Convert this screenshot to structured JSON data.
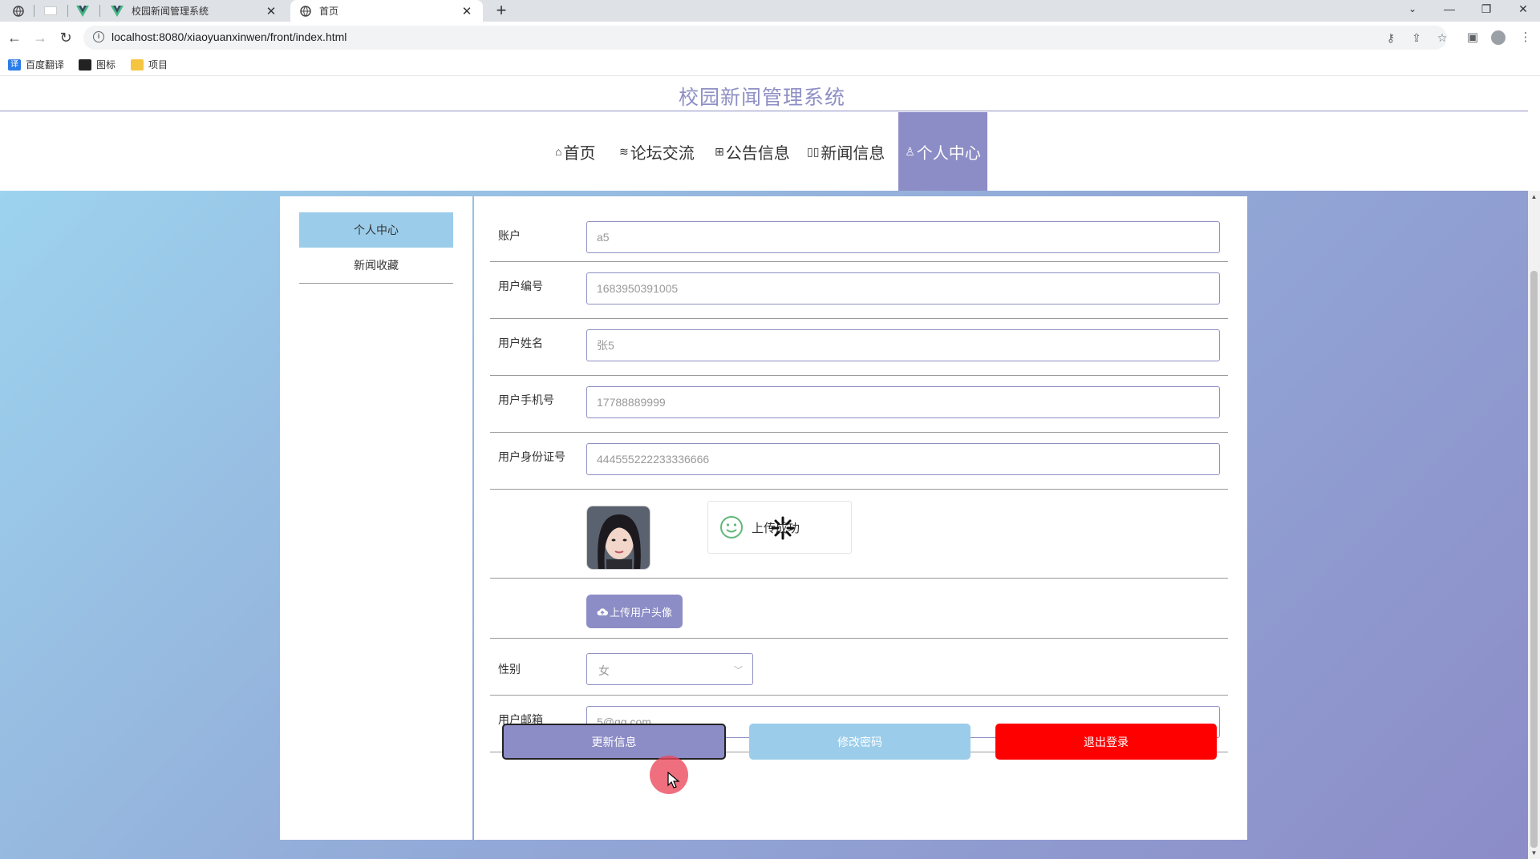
{
  "browser": {
    "tabs": [
      {
        "title": "校园新闻管理系统",
        "icon": "vue-logo-icon"
      },
      {
        "title": "首页",
        "icon": "globe-icon"
      }
    ],
    "close_glyph": "✕",
    "new_tab_glyph": "+",
    "url": "localhost:8080/xiaoyuanxinwen/front/index.html",
    "bookmarks": [
      "百度翻译",
      "图标",
      "项目"
    ],
    "window_controls": {
      "minimize": "—",
      "restore": "❐",
      "close": "✕"
    }
  },
  "site": {
    "title": "校园新闻管理系统",
    "nav": [
      {
        "label": "首页",
        "icon": "home-icon",
        "glyph": "⌂"
      },
      {
        "label": "论坛交流",
        "icon": "layers-icon",
        "glyph": "≋"
      },
      {
        "label": "公告信息",
        "icon": "grid-icon",
        "glyph": "⊞"
      },
      {
        "label": "新闻信息",
        "icon": "columns-icon",
        "glyph": "▯▯"
      },
      {
        "label": "个人中心",
        "icon": "user-icon",
        "glyph": "♙",
        "active": true
      }
    ]
  },
  "sidebar": {
    "items": [
      {
        "label": "个人中心",
        "active": true
      },
      {
        "label": "新闻收藏",
        "active": false
      }
    ]
  },
  "form": {
    "fields": [
      {
        "label": "账户",
        "value": "a5"
      },
      {
        "label": "用户编号",
        "value": "1683950391005"
      },
      {
        "label": "用户姓名",
        "value": "张5"
      },
      {
        "label": "用户手机号",
        "value": "17788889999"
      },
      {
        "label": "用户身份证号",
        "value": "444555222233336666"
      }
    ],
    "upload_toast": "上传成功",
    "upload_button": "上传用户头像",
    "gender": {
      "label": "性别",
      "value": "女"
    },
    "email": {
      "label": "用户邮箱",
      "value": "5@qq.com"
    },
    "buttons": {
      "update": "更新信息",
      "password": "修改密码",
      "logout": "退出登录"
    }
  },
  "colors": {
    "primary": "#8c8cc6",
    "secondary": "#9bcdea",
    "danger": "#ff0000"
  }
}
